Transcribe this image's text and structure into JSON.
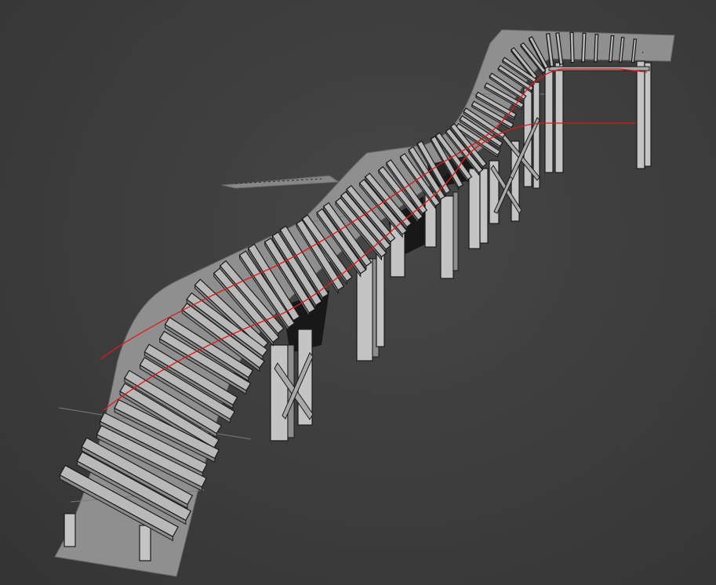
{
  "viewport": {
    "background_color": "#3e3e3e",
    "ground_color": "#8f8f8f",
    "plank_color": "#b9b9b9",
    "spline_color": "#e01818"
  }
}
